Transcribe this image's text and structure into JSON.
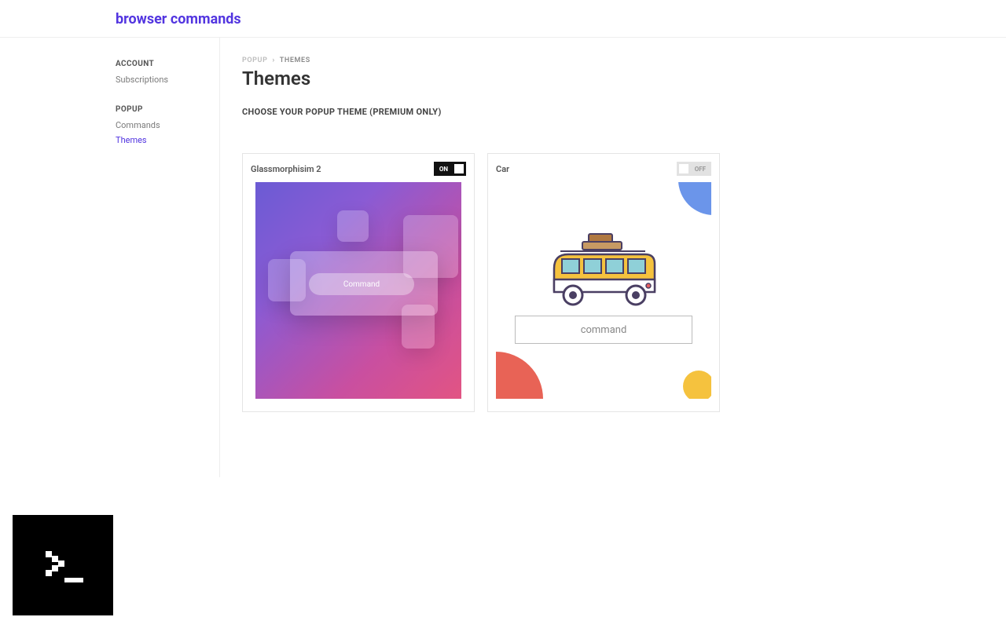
{
  "header": {
    "brand": "browser commands"
  },
  "sidebar": {
    "groups": [
      {
        "title": "ACCOUNT",
        "items": [
          {
            "label": "Subscriptions",
            "active": false
          }
        ]
      },
      {
        "title": "POPUP",
        "items": [
          {
            "label": "Commands",
            "active": false
          },
          {
            "label": "Themes",
            "active": true
          }
        ]
      }
    ]
  },
  "breadcrumb": {
    "parent": "POPUP",
    "separator": "›",
    "current": "THEMES"
  },
  "page": {
    "title": "Themes",
    "subheading": "CHOOSE YOUR POPUP THEME (PREMIUM ONLY)"
  },
  "themes": [
    {
      "name": "Glassmorphisim 2",
      "enabled": true,
      "toggle_label": "ON",
      "preview_kind": "glass",
      "preview_label": "Command"
    },
    {
      "name": "Car",
      "enabled": false,
      "toggle_label": "OFF",
      "preview_kind": "car",
      "preview_label": "command"
    }
  ]
}
